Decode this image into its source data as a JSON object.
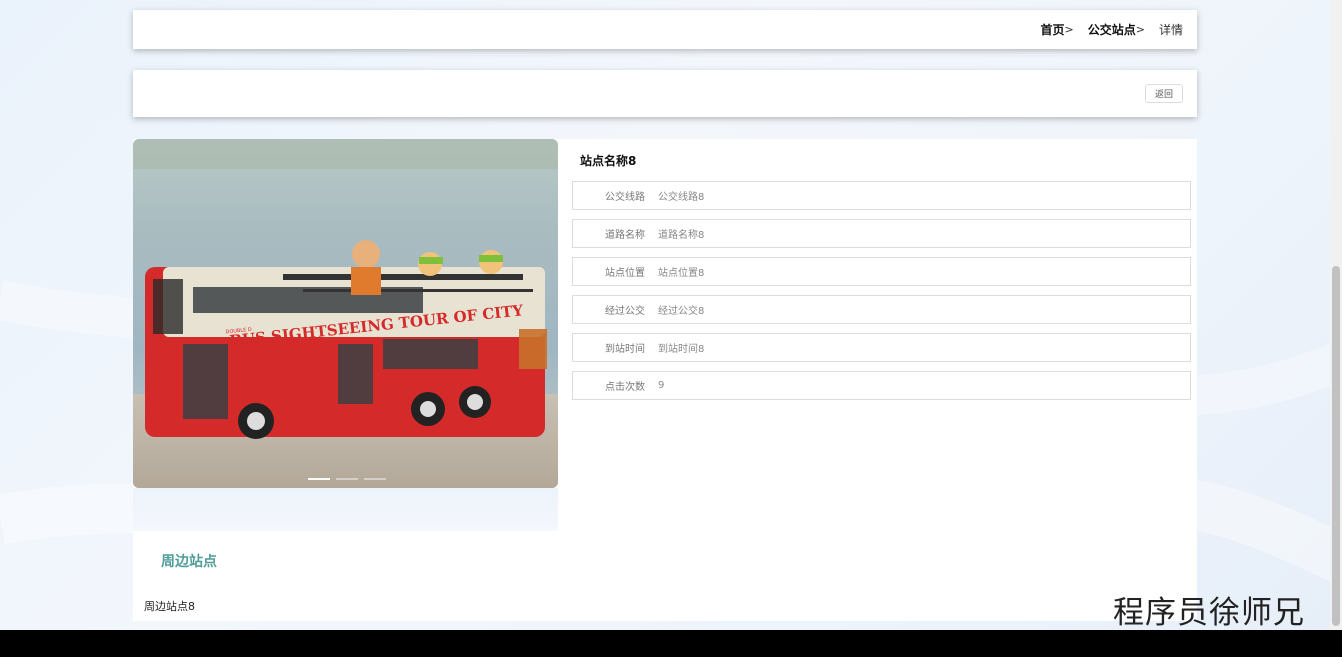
{
  "breadcrumb": {
    "home": "首页",
    "separator": ">",
    "section": "公交站点",
    "current": "详情"
  },
  "actions": {
    "back_label": "返回"
  },
  "station": {
    "name": "站点名称8",
    "fields": [
      {
        "label": "公交线路",
        "value": "公交线路8"
      },
      {
        "label": "道路名称",
        "value": "道路名称8"
      },
      {
        "label": "站点位置",
        "value": "站点位置8"
      },
      {
        "label": "经过公交",
        "value": "经过公交8"
      },
      {
        "label": "到站时间",
        "value": "到站时间8"
      },
      {
        "label": "点击次数",
        "value": "9"
      }
    ]
  },
  "photo": {
    "bus_text": "BUS SIGHTSEEING TOUR OF CITY",
    "bus_subtext": "DOUBLE D",
    "carousel": {
      "slides": 3,
      "active": 1
    }
  },
  "nearby": {
    "title": "周边站点",
    "content": "周边站点8"
  },
  "watermark": "程序员徐师兄",
  "colors": {
    "accent": "#4f9c9a",
    "bus_red": "#d42a2a"
  }
}
